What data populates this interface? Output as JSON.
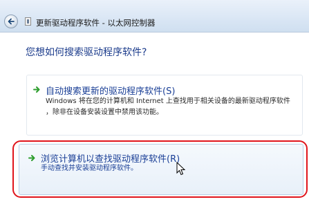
{
  "window": {
    "title": "更新驱动程序软件 - 以太网控制器"
  },
  "question": "您想如何搜索驱动程序软件?",
  "options": [
    {
      "title": "自动搜索更新的驱动程序软件(S)",
      "desc_line1": "Windows 将在您的计算机和 Internet 上查找用于相关设备的最新驱动程序软件",
      "desc_line2": "，除非在设备安装设置中禁用该功能。"
    },
    {
      "title": "浏览计算机以查找驱动程序软件(R)",
      "desc_line1": "手动查找并安装驱动程序软件。"
    }
  ],
  "colors": {
    "link_blue": "#1a3f96",
    "arrow_green": "#2e9e2e",
    "highlight_red": "#e0141b"
  },
  "icons": {
    "back": "back-arrow-icon",
    "app": "device-icon",
    "option_arrow": "green-arrow-icon",
    "cursor": "mouse-pointer-icon"
  }
}
